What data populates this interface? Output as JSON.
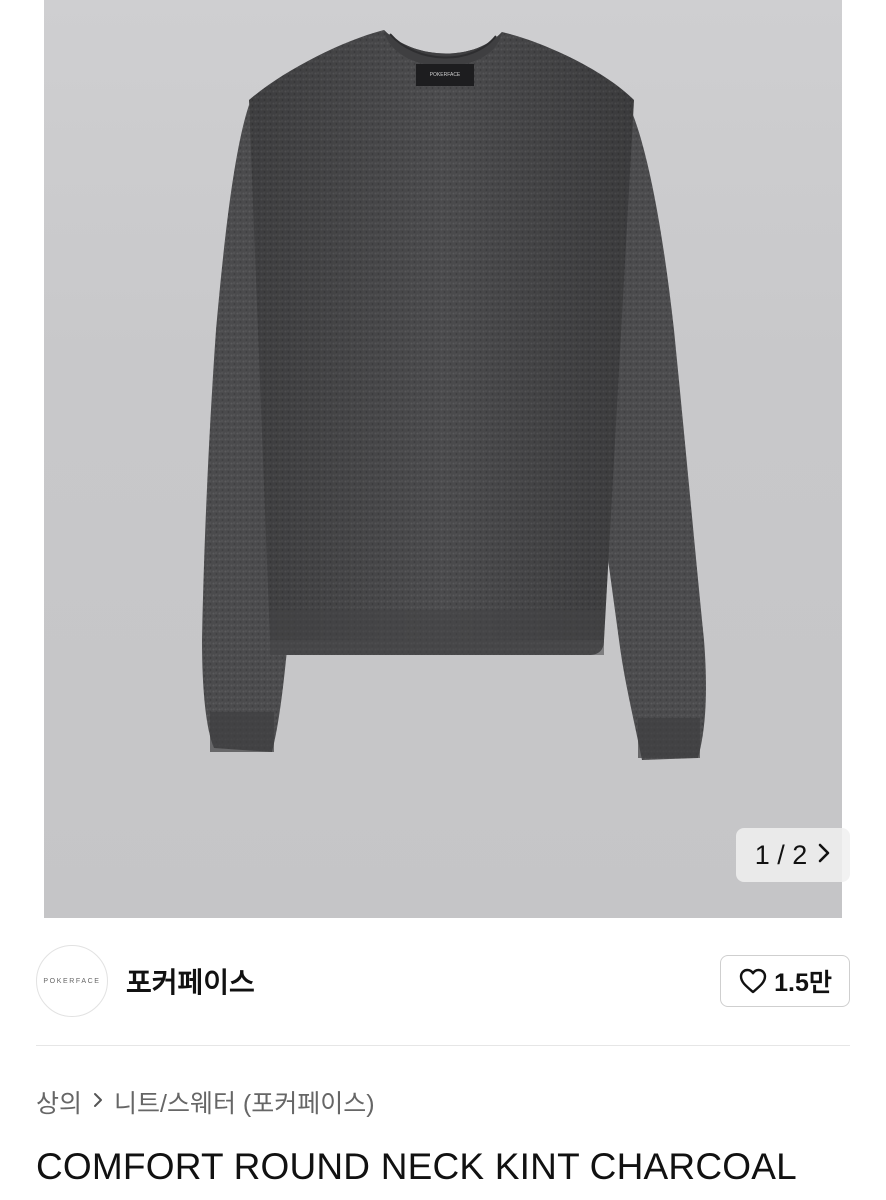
{
  "gallery": {
    "current": "1 / 2",
    "next_icon": "chevron-right-icon",
    "label_text": "POKERFACE"
  },
  "seller": {
    "avatar_text": "POKERFACE",
    "name": "포커페이스",
    "like_icon": "heart-outline-icon",
    "like_count": "1.5만"
  },
  "category": {
    "items": [
      "상의",
      "니트/스웨터 (포커페이스)"
    ],
    "separator_icon": "chevron-right-icon"
  },
  "product": {
    "title": "COMFORT ROUND NECK KINT CHARCOAL"
  },
  "colors": {
    "photo_bg": "#c8c8ca",
    "sweater": "#4a4a4c"
  }
}
